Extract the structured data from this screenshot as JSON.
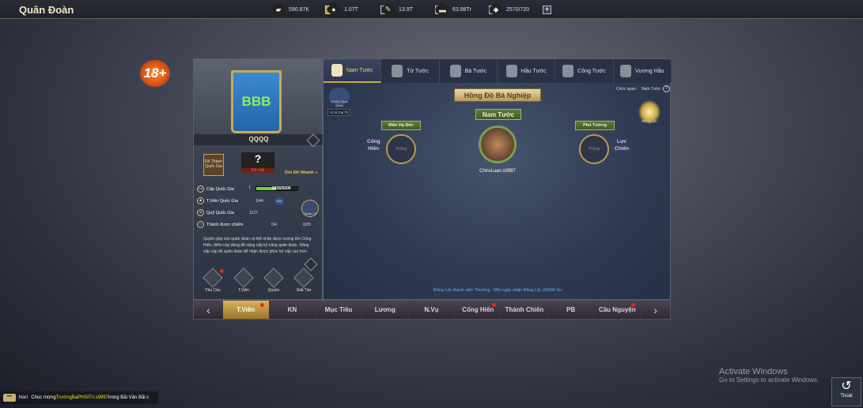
{
  "header": {
    "title": "Quân Đoàn"
  },
  "currencies": [
    {
      "icon": "gold-ingot-icon",
      "glyph": "▰",
      "value": "590.87K"
    },
    {
      "icon": "silver-coin-icon",
      "glyph": "●",
      "value": "1.07T"
    },
    {
      "icon": "wheat-icon",
      "glyph": "✎",
      "value": "13.9T"
    },
    {
      "icon": "wood-icon",
      "glyph": "▬",
      "value": "63.88Tr"
    },
    {
      "icon": "meat-icon",
      "glyph": "◆",
      "value": "2570/720"
    }
  ],
  "age_badge": "18+",
  "left": {
    "banner_text": "BBB",
    "guild_name": "QQQQ",
    "capital_label": "Đô Thành Quốc Gia",
    "lost_mark": "?",
    "lost_label": "Đã mất",
    "quick_move": "Dời Đô Nhanh »",
    "rows": [
      {
        "icon": "Lv",
        "label": "Cấp Quốc Gia",
        "value": "2436/5000",
        "level": "I",
        "progress": 0.49
      },
      {
        "icon": "♟",
        "label": "T.Viên Quốc Gia",
        "value": "1/44",
        "badge": "Mời"
      },
      {
        "icon": "◎",
        "label": "Quỹ Quốc Gia",
        "value": "1127"
      },
      {
        "icon": "⌂",
        "label": "Thành được chiếm",
        "value1": "0/4",
        "value2": "0/20"
      }
    ],
    "manage": "Quản Lý",
    "description": "Quyên góp cho quân đoàn có thể nhận được lượng lớn Cống Hiến, điểm này dùng để nâng cấp kỹ năng quân đoàn. Nâng cấp cấp độ quân đoàn để nhận được phúc lợi cấp cao hơn.",
    "buttons": [
      "Yêu Cầu",
      "T.Viên",
      "Quyền",
      "Giải Tán"
    ]
  },
  "ranks": [
    {
      "label": "Nam Tước",
      "active": true
    },
    {
      "label": "Tử Tước"
    },
    {
      "label": "Bá Tước"
    },
    {
      "label": "Hầu Tước"
    },
    {
      "label": "Công Tước"
    },
    {
      "label": "Vương Hầu"
    }
  ],
  "main": {
    "record_label": "B.Xếp Chức Quan",
    "position_btn": "Vị Vi Cai Trị",
    "heading": "Hồng Đồ Bá Nghiệp",
    "office_label": "Chức quan :",
    "office_value": "Nam Tước",
    "salary_label": "Bổng Lộc",
    "center_title": "Nam Tước",
    "center_name": "ChiroLuan.s9997",
    "left_title": "Môn Hạ Đốc",
    "left_slot": "Trống",
    "left_side": "Cống Hiến",
    "right_title": "Phó Tướng",
    "right_slot": "Trống",
    "right_side": "Lực Chiến",
    "info": "Bổng Lộc thành viên Thường :   Mỗi ngày nhận Bổng Lộc 20000 Xu"
  },
  "tabs": [
    {
      "label": "T.Viên",
      "active": true,
      "dot": true
    },
    {
      "label": "KN"
    },
    {
      "label": "Mục Tiêu"
    },
    {
      "label": "Lương"
    },
    {
      "label": "N.Vụ"
    },
    {
      "label": "Cống Hiến",
      "dot": true
    },
    {
      "label": "Thành Chiến"
    },
    {
      "label": "PB"
    },
    {
      "label": "Cầu Nguyện",
      "dot": true
    }
  ],
  "chat": {
    "prefix": "húc!",
    "text1": "Chúc mừng",
    "player": "TrườngBaPhiSiTri.s9997",
    "text2": "trong Bãi Văn Bãi c"
  },
  "watermark": {
    "line1": "Activate Windows",
    "line2": "Go to Settings to activate Windows."
  },
  "exit_label": "Thoát"
}
